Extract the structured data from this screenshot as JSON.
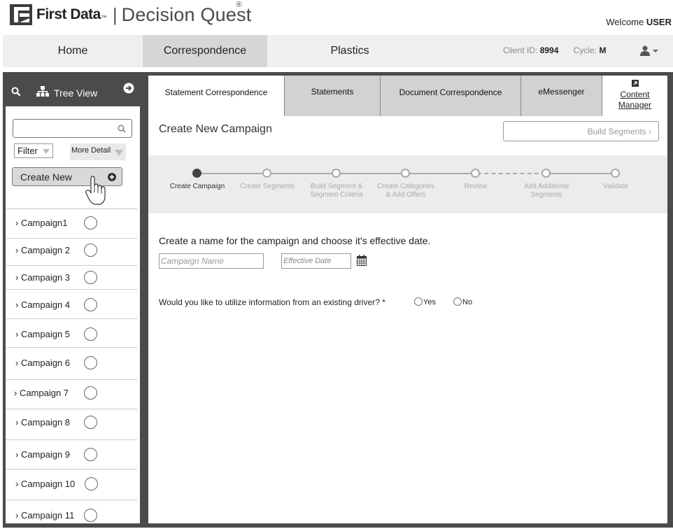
{
  "header": {
    "brand": "First Data",
    "brand_tm": "™",
    "separator": "|",
    "product": "Decision Quest",
    "registered": "®",
    "welcome_prefix": "Welcome",
    "welcome_user": "USER"
  },
  "topnav": {
    "items": [
      {
        "label": "Home"
      },
      {
        "label": "Correspondence",
        "active": true
      },
      {
        "label": "Plastics"
      }
    ],
    "client_id_label": "Client ID:",
    "client_id_value": "8994",
    "cycle_label": "Cycle:",
    "cycle_value": "M",
    "user_icon": "user-icon"
  },
  "sidebar": {
    "tree_view_label": "Tree View",
    "search_placeholder": "",
    "filter_label": "Filter",
    "more_detail_label": "More Detail",
    "create_new_label": "Create New",
    "campaigns": [
      {
        "label": "› Campaign1"
      },
      {
        "label": "› Campaign 2"
      },
      {
        "label": "› Campaign 3"
      },
      {
        "label": "› Campaign 4"
      },
      {
        "label": "› Campaign 5"
      },
      {
        "label": "› Campaign 6"
      },
      {
        "label": "› Campaign 7"
      },
      {
        "label": "› Campaign 8"
      },
      {
        "label": "› Campaign 9"
      },
      {
        "label": "› Campaign 10"
      },
      {
        "label": "› Campaign 11"
      }
    ]
  },
  "tabs": [
    {
      "label": "Statement Correspondence",
      "active": true
    },
    {
      "label": "Statements"
    },
    {
      "label": "Document Correspondence"
    },
    {
      "label": "eMessenger"
    },
    {
      "label_line1": "Content",
      "label_line2": "Manager"
    }
  ],
  "main": {
    "title": "Create New Campaign",
    "build_segments_label": "Build Segments ›",
    "steps": [
      {
        "line1": "Create Campaign",
        "line2": "",
        "done": true
      },
      {
        "line1": "Create Segments",
        "line2": ""
      },
      {
        "line1": "Build Segment &",
        "line2": "Segment Criteria"
      },
      {
        "line1": "Create Categories",
        "line2": "& Add Offers"
      },
      {
        "line1": "Review",
        "line2": ""
      },
      {
        "line1": "Add Additional",
        "line2": "Segments"
      },
      {
        "line1": "Validate",
        "line2": ""
      }
    ],
    "prompt": "Create a name for the campaign and choose it's effective date.",
    "campaign_name_placeholder": "Campaign Name",
    "effective_date_placeholder": "Effective Date",
    "question": "Would you like to utilize information from an existing driver? *",
    "yes_label": "Yes",
    "no_label": "No"
  }
}
